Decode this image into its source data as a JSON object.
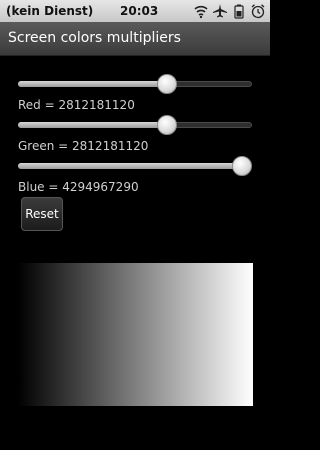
{
  "status_bar": {
    "carrier": "(kein Dienst)",
    "time": "20:03",
    "icons": [
      "wifi-icon",
      "airplane-icon",
      "battery-icon",
      "alarm-icon"
    ]
  },
  "title_bar": {
    "title": "Screen colors multipliers"
  },
  "sliders": {
    "red": {
      "label": "Red = 2812181120",
      "level": 0.65
    },
    "green": {
      "label": "Green = 2812181120",
      "level": 0.65
    },
    "blue": {
      "label": "Blue = 4294967290",
      "level": 1.0
    }
  },
  "reset_label": "Reset",
  "colors": {
    "preview_start": "#000000",
    "preview_end": "#ffffff"
  }
}
